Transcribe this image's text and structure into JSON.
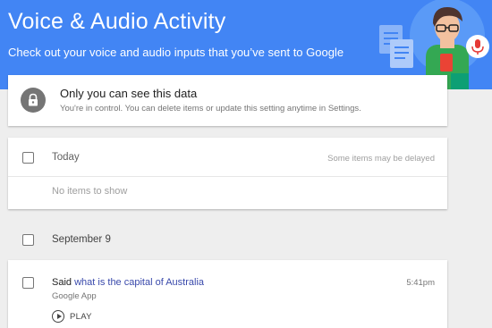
{
  "header": {
    "title": "Voice & Audio Activity",
    "subtitle": "Check out your voice and audio inputs that you’ve sent to Google"
  },
  "privacy": {
    "icon": "lock-icon",
    "title": "Only you can see this data",
    "description": "You're in control. You can delete items or update this setting anytime in Settings."
  },
  "today": {
    "label": "Today",
    "note": "Some items may be delayed",
    "empty": "No items to show"
  },
  "date_group": {
    "label": "September 9"
  },
  "activity_item": {
    "prefix": "Said",
    "query": "what is the capital of Australia",
    "time": "5:41pm",
    "source": "Google App",
    "play_label": "PLAY"
  },
  "colors": {
    "header_bg": "#4285f4",
    "page_bg": "#eeeeee",
    "link": "#3949ab",
    "mic_red": "#e53935"
  }
}
